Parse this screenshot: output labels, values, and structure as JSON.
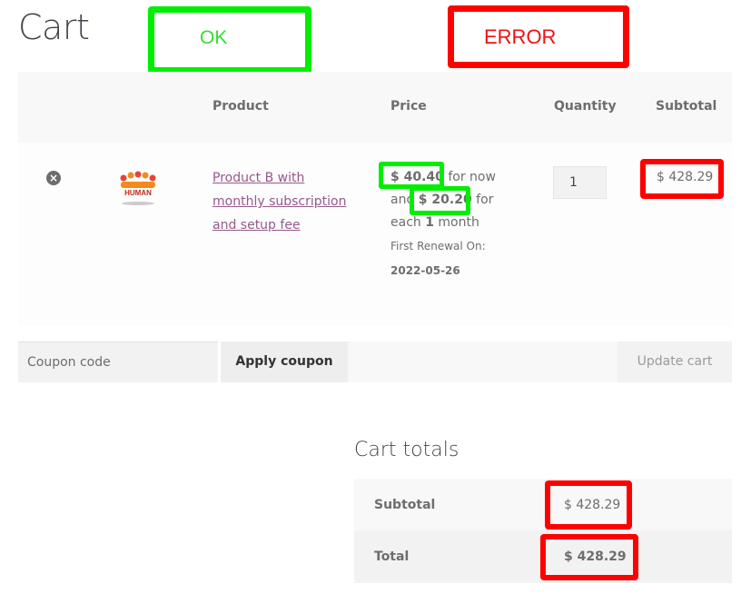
{
  "page": {
    "title": "Cart"
  },
  "annotations": {
    "ok_label": "OK",
    "error_label": "ERROR",
    "ok_color": "#00ee00",
    "error_color": "#ff0000"
  },
  "table": {
    "headers": {
      "product": "Product",
      "price": "Price",
      "quantity": "Quantity",
      "subtotal": "Subtotal"
    },
    "row": {
      "remove_icon": "close-circle-icon",
      "image_label": "HUMAN",
      "product_name": "Product B with monthly subscription and setup fee",
      "price_amount": "$ 40.40",
      "price_text_1": " for now",
      "price_text_2": "and ",
      "recurring_amount": "$ 20.20",
      "price_text_3": " for",
      "price_text_4": "each ",
      "period_count": "1",
      "period_unit": " month",
      "renewal_label": "First Renewal On:",
      "renewal_date": "2022-05-26",
      "quantity": "1",
      "subtotal": "$ 428.29"
    }
  },
  "actions": {
    "coupon_placeholder": "Coupon code",
    "apply_label": "Apply coupon",
    "update_label": "Update cart"
  },
  "totals": {
    "title": "Cart totals",
    "subtotal_label": "Subtotal",
    "subtotal_value": "$ 428.29",
    "total_label": "Total",
    "total_value": "$ 428.29"
  }
}
